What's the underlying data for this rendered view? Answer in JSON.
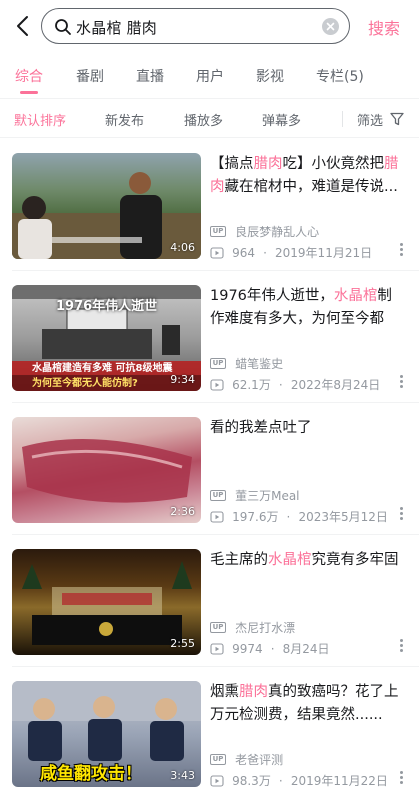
{
  "header": {
    "search_query": "水晶棺 腊肉",
    "search_button": "搜索"
  },
  "tabs": [
    {
      "label": "综合",
      "active": true
    },
    {
      "label": "番剧"
    },
    {
      "label": "直播"
    },
    {
      "label": "用户"
    },
    {
      "label": "影视"
    },
    {
      "label": "专栏(5)"
    }
  ],
  "sort": {
    "options": [
      {
        "label": "默认排序",
        "active": true
      },
      {
        "label": "新发布"
      },
      {
        "label": "播放多"
      },
      {
        "label": "弹幕多"
      }
    ],
    "filter_label": "筛选"
  },
  "results": [
    {
      "title_parts": [
        {
          "text": "【搞点"
        },
        {
          "text": "腊肉",
          "hl": true
        },
        {
          "text": "吃】小伙竟然把"
        },
        {
          "text": "腊肉",
          "hl": true
        },
        {
          "text": "藏在棺材中，难道是传说..."
        }
      ],
      "up_badge": "UP",
      "uploader": "良辰梦静乱人心",
      "views": "964",
      "date": "2019年11月21日",
      "duration": "4:06",
      "thumb_caption": "",
      "thumb_overlay": ""
    },
    {
      "title_parts": [
        {
          "text": "1976年伟人逝世，"
        },
        {
          "text": "水晶棺",
          "hl": true
        },
        {
          "text": "制作难度有多大，为何至今都无..."
        }
      ],
      "up_badge": "UP",
      "uploader": "蜡笔鉴史",
      "views": "62.1万",
      "date": "2022年8月24日",
      "duration": "9:34",
      "thumb_caption": "1976年伟人逝世",
      "thumb_overlay": "水晶棺建造有多难 可抗8级地震",
      "thumb_overlay2": "为何至今都无人能仿制?"
    },
    {
      "title_parts": [
        {
          "text": "看的我差点吐了"
        }
      ],
      "up_badge": "UP",
      "uploader": "董三万Meal",
      "views": "197.6万",
      "date": "2023年5月12日",
      "duration": "2:36"
    },
    {
      "title_parts": [
        {
          "text": "毛主席的"
        },
        {
          "text": "水晶棺",
          "hl": true
        },
        {
          "text": "究竟有多牢固"
        }
      ],
      "up_badge": "UP",
      "uploader": "杰尼打水漂",
      "views": "9974",
      "date": "8月24日",
      "duration": "2:55"
    },
    {
      "title_parts": [
        {
          "text": "烟熏"
        },
        {
          "text": "腊肉",
          "hl": true
        },
        {
          "text": "真的致癌吗？花了上万元检测费，结果竟然......"
        }
      ],
      "up_badge": "UP",
      "uploader": "老爸评测",
      "views": "98.3万",
      "date": "2019年11月22日",
      "duration": "3:43",
      "thumb_overlay": "咸鱼翻攻击！"
    }
  ],
  "colors": {
    "accent": "#fb7299",
    "text_primary": "#18191c",
    "text_secondary": "#61666d",
    "text_meta": "#9499a0"
  }
}
